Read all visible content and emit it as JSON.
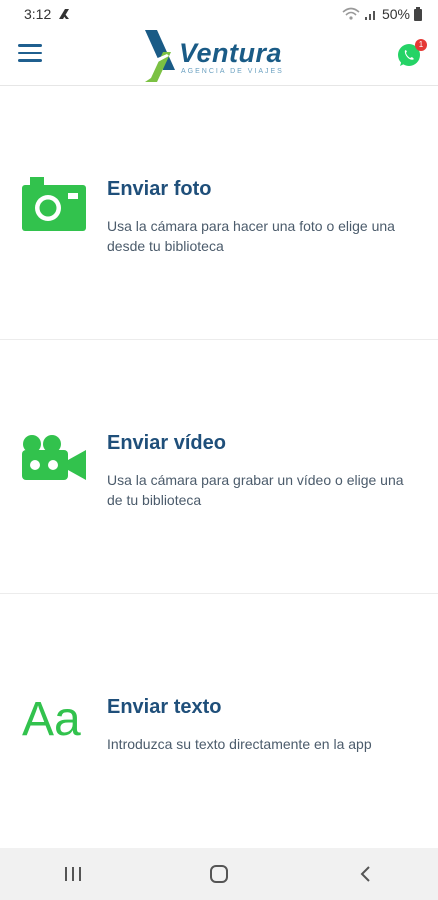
{
  "status": {
    "time": "3:12",
    "battery": "50%"
  },
  "header": {
    "brand": "Ventura",
    "tagline": "AGENCIA DE VIAJES",
    "whatsapp_badge": "1"
  },
  "options": [
    {
      "title": "Enviar foto",
      "description": "Usa la cámara para hacer una foto o elige una desde tu biblioteca"
    },
    {
      "title": "Enviar vídeo",
      "description": "Usa la cámara para grabar un vídeo o elige una de tu biblioteca"
    },
    {
      "title": "Enviar texto",
      "description": "Introduzca su texto directamente en la app",
      "icon_text": "Aa"
    }
  ],
  "colors": {
    "brand_blue": "#1a5b86",
    "icon_green": "#32c24d",
    "whatsapp_green": "#25d366"
  }
}
